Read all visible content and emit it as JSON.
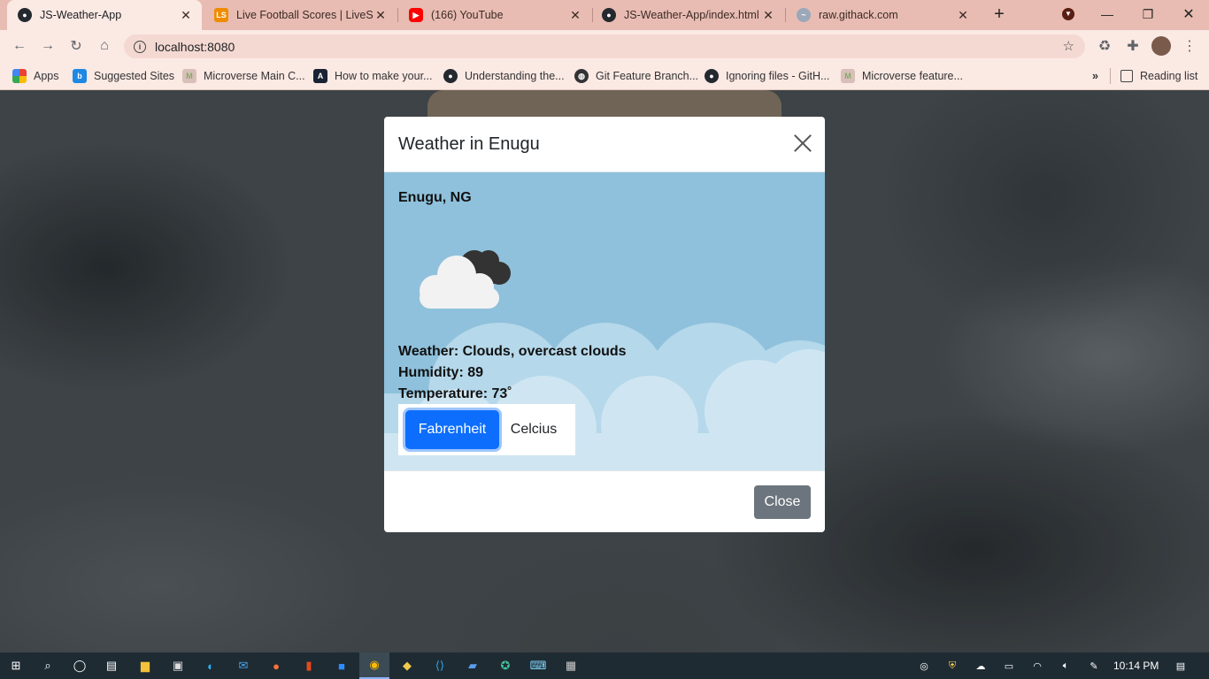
{
  "browser": {
    "tabs": [
      {
        "title": "JS-Weather-App",
        "icon": "github-icon",
        "active": true
      },
      {
        "title": "Live Football Scores | LiveScore",
        "icon": "livescore-icon",
        "active": false
      },
      {
        "title": "(166) YouTube",
        "icon": "youtube-icon",
        "active": false
      },
      {
        "title": "JS-Weather-App/index.html at",
        "icon": "github-icon",
        "active": false
      },
      {
        "title": "raw.githack.com",
        "icon": "githack-icon",
        "active": false
      }
    ],
    "url": "localhost:8080",
    "bookmarks": [
      {
        "label": "Apps",
        "icon": "apps-grid-icon"
      },
      {
        "label": "Suggested Sites",
        "icon": "bing-icon"
      },
      {
        "label": "Microverse Main C...",
        "icon": "microverse-icon"
      },
      {
        "label": "How to make your...",
        "icon": "arch-icon"
      },
      {
        "label": "Understanding the...",
        "icon": "github-icon"
      },
      {
        "label": "Git Feature Branch...",
        "icon": "web-icon"
      },
      {
        "label": "Ignoring files - GitH...",
        "icon": "github-icon"
      },
      {
        "label": "Microverse feature...",
        "icon": "microverse-icon"
      }
    ],
    "reading_list": "Reading list"
  },
  "modal": {
    "title": "Weather in Enugu",
    "location": "Enugu, NG",
    "weather": "Weather: Clouds, overcast clouds",
    "humidity": "Humidity: 89",
    "temperature": "Temperature: 73˚",
    "fahrenheit_label": "Fabrenheit",
    "celsius_label": "Celcius",
    "close_label": "Close",
    "selected_unit": "Fabrenheit",
    "accent_color": "#0d6efd",
    "body_color": "#8fc1dc"
  },
  "taskbar": {
    "time": "10:14 PM"
  }
}
